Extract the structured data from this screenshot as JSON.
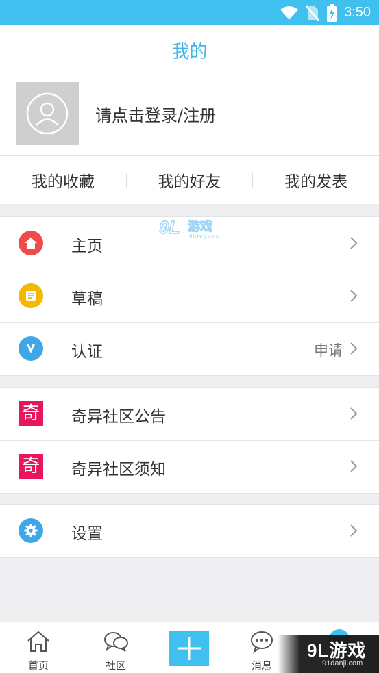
{
  "status_bar": {
    "time": "3:50",
    "background": "#3fc0ee"
  },
  "header": {
    "title": "我的"
  },
  "profile": {
    "login_text": "请点击登录/注册"
  },
  "quick_links": [
    {
      "label": "我的收藏"
    },
    {
      "label": "我的好友"
    },
    {
      "label": "我的发表"
    }
  ],
  "menu_groups": [
    {
      "rows": [
        {
          "label": "主页",
          "icon": "home-icon",
          "color": "#ef4b4b"
        },
        {
          "label": "草稿",
          "icon": "draft-icon",
          "color": "#f5b800"
        },
        {
          "label": "认证",
          "icon": "verify-icon",
          "color": "#3fa7e8",
          "extra": "申请"
        }
      ]
    },
    {
      "rows": [
        {
          "label": "奇异社区公告",
          "icon": "qi-icon",
          "glyph": "奇",
          "color": "#e6175b"
        },
        {
          "label": "奇异社区须知",
          "icon": "qi-icon",
          "glyph": "奇",
          "color": "#e6175b"
        }
      ]
    },
    {
      "rows": [
        {
          "label": "设置",
          "icon": "gear-icon",
          "color": "#3fa7e8"
        }
      ]
    }
  ],
  "tab_bar": {
    "tabs": [
      {
        "label": "首页",
        "icon": "home-outline-icon"
      },
      {
        "label": "社区",
        "icon": "chat-bubbles-icon"
      },
      {
        "label": "",
        "icon": "plus-icon"
      },
      {
        "label": "消息",
        "icon": "message-icon"
      }
    ]
  },
  "watermark": {
    "brand": "9L游戏",
    "site": "91danji.com"
  },
  "colors": {
    "accent": "#3fc0ee",
    "title": "#3fb6e8",
    "qi_red": "#e6175b"
  }
}
